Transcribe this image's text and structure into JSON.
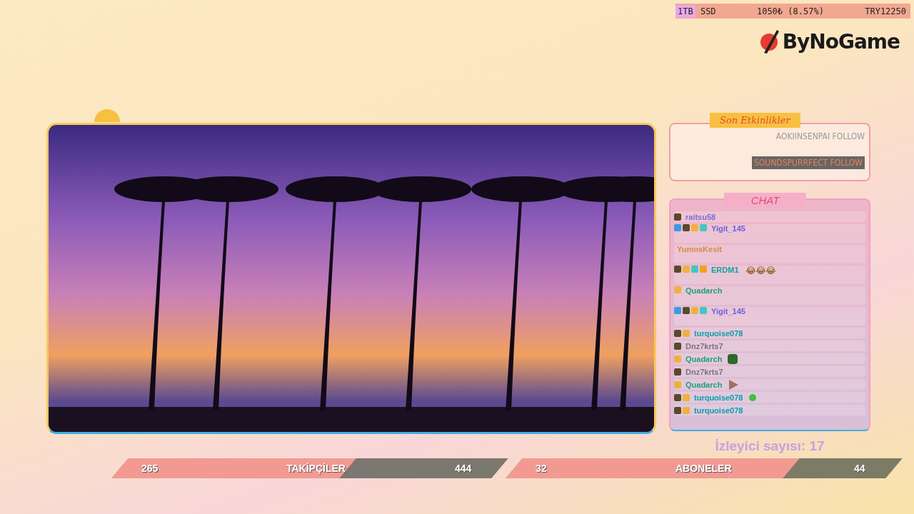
{
  "stats_bar": {
    "item_highlight": "1TB",
    "item_rest": "SSD",
    "price_change": "1050₺ (8.57%)",
    "price": "TRY12250"
  },
  "logo": {
    "text": "ByNoGame"
  },
  "recent_events": {
    "title": "Son Etkinlikler",
    "events": [
      {
        "text": "AOKIINSENPAI FOLLOW",
        "selected": false
      }
    ],
    "latest": {
      "text": "SOUNDSPURRFECT FOLLOW",
      "selected": true
    }
  },
  "chat": {
    "title": "CHAT",
    "messages": [
      {
        "kind": "plain",
        "user": "raitsu58",
        "color": "#7a6fd8",
        "hammer": false,
        "hex": true,
        "crown": false,
        "gem": false,
        "coin": false
      },
      {
        "kind": "plain",
        "user": "Yigit_145",
        "color": "#6a5fe0",
        "hammer": true,
        "hex": true,
        "crown": true,
        "gem": true,
        "coin": false
      },
      {
        "kind": "plain",
        "user": "YumosKesit",
        "color": "#d88a40",
        "hammer": false,
        "hex": false,
        "crown": false,
        "gem": false,
        "coin": false
      },
      {
        "kind": "plain",
        "user": "ERDM1",
        "color": "#11a39c",
        "hammer": false,
        "hex": true,
        "crown": true,
        "gem": true,
        "coin": true,
        "emote_text": "😂😂😂"
      },
      {
        "kind": "plain",
        "user": "Quadarch",
        "color": "#1f9f78",
        "hammer": false,
        "hex": false,
        "crown": true,
        "gem": false,
        "coin": false
      },
      {
        "kind": "plain",
        "user": "Yigit_145",
        "color": "#6a5fe0",
        "hammer": true,
        "hex": true,
        "crown": true,
        "gem": true,
        "coin": false
      },
      {
        "kind": "plain",
        "user": "turquoise078",
        "color": "#0c9cb0",
        "hammer": false,
        "hex": true,
        "crown": true,
        "gem": false,
        "coin": false
      },
      {
        "kind": "plain",
        "user": "Dnz7krts7",
        "color": "#7d7080",
        "hammer": false,
        "hex": true,
        "crown": false,
        "gem": false,
        "coin": false
      },
      {
        "kind": "frog",
        "user": "Quadarch",
        "color": "#1f9f78",
        "hammer": false,
        "hex": false,
        "crown": true,
        "gem": false,
        "coin": false
      },
      {
        "kind": "plain",
        "user": "Dnz7krts7",
        "color": "#7d7080",
        "hammer": false,
        "hex": true,
        "crown": false,
        "gem": false,
        "coin": false
      },
      {
        "kind": "play",
        "user": "Quadarch",
        "color": "#1f9f78",
        "hammer": false,
        "hex": false,
        "crown": true,
        "gem": false,
        "coin": false
      },
      {
        "kind": "alien",
        "user": "turquoise078",
        "color": "#0c9cb0",
        "hammer": false,
        "hex": true,
        "crown": true,
        "gem": false,
        "coin": false
      },
      {
        "kind": "plain",
        "user": "turquoise078",
        "color": "#0c9cb0",
        "hammer": false,
        "hex": true,
        "crown": true,
        "gem": false,
        "coin": false
      }
    ]
  },
  "viewers": {
    "label": "İzleyici sayısı: 17"
  },
  "goals": [
    {
      "current": "265",
      "label": "TAKİPÇİLER",
      "target": "444",
      "level": 0.6
    },
    {
      "current": "32",
      "label": "ABONELER",
      "target": "44",
      "level": 0.73
    }
  ]
}
